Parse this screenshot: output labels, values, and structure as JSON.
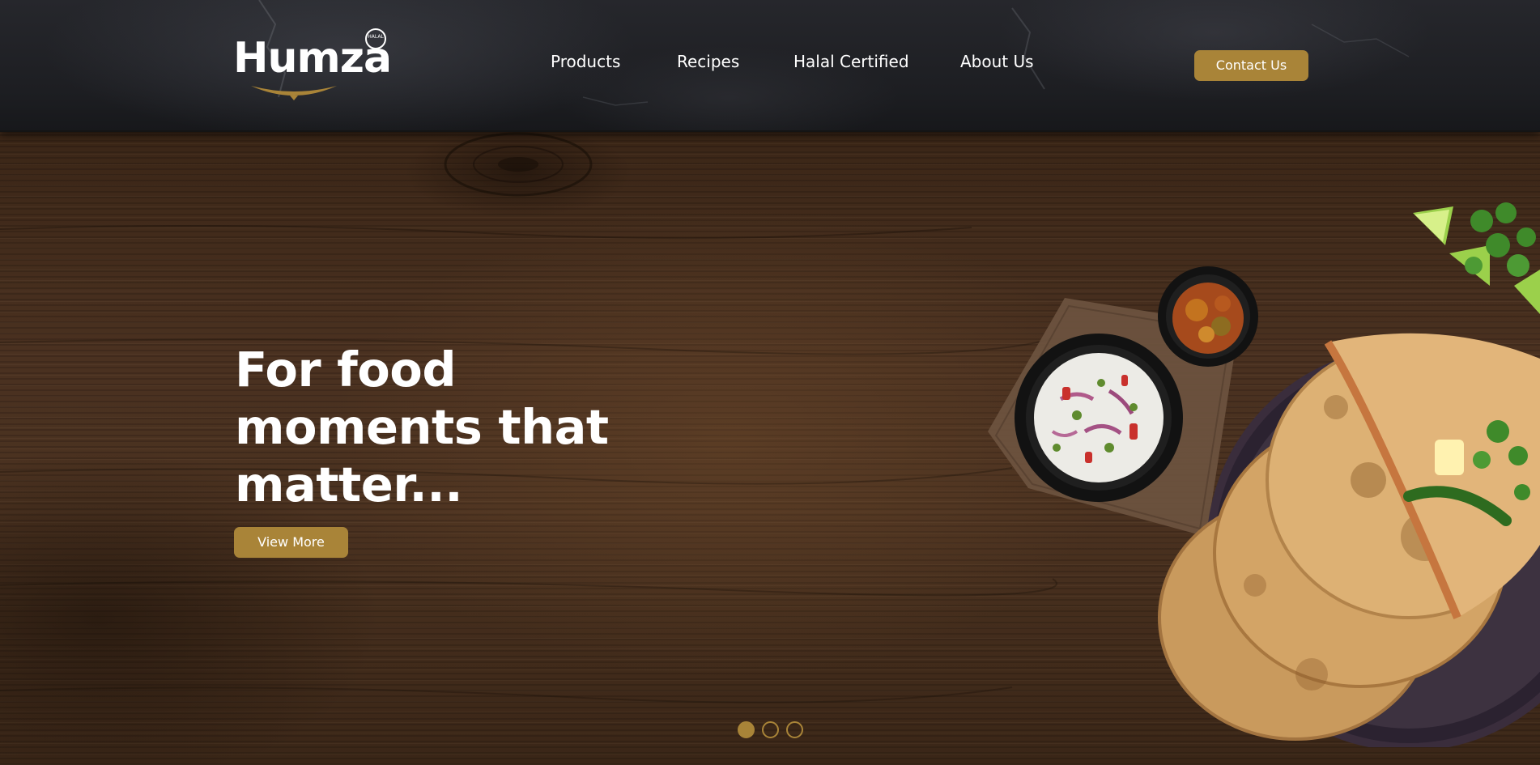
{
  "brand": {
    "name": "Humza",
    "badge": "HALAL"
  },
  "nav": {
    "items": [
      {
        "label": "Products"
      },
      {
        "label": "Recipes"
      },
      {
        "label": "Halal Certified"
      },
      {
        "label": "About Us"
      }
    ],
    "contact_label": "Contact Us"
  },
  "hero": {
    "headline_lines": [
      "For food",
      "moments that",
      "matter..."
    ],
    "cta_label": "View More"
  },
  "carousel": {
    "slide_count": 3,
    "active_index": 0
  },
  "colors": {
    "accent": "#a98438",
    "header_bg": "#1f2024",
    "wood": "#4a3120",
    "text": "#ffffff"
  },
  "icons": [
    "halal-badge-icon",
    "logo-swoosh-icon"
  ]
}
